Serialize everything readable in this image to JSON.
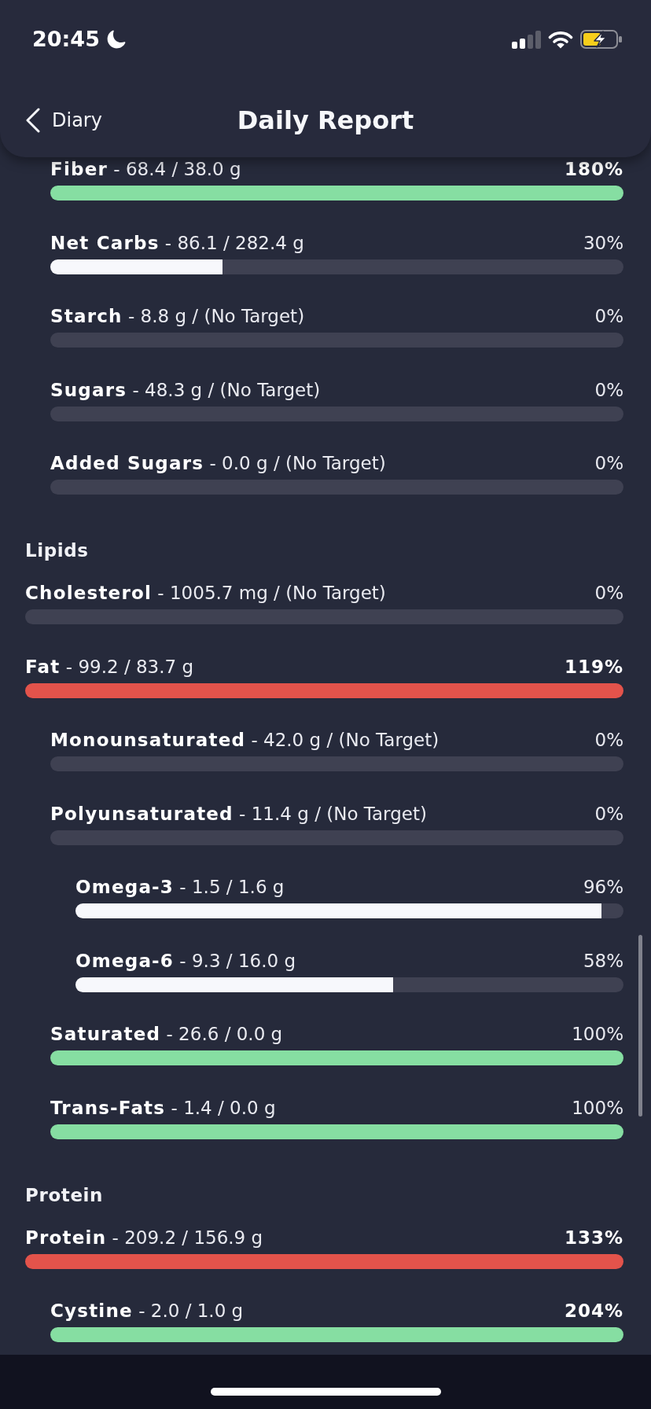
{
  "status_bar": {
    "time": "20:45"
  },
  "nav": {
    "back_label": "Diary",
    "title": "Daily Report"
  },
  "sections": [
    {
      "rows": [
        {
          "children": [
            {
              "label": "**Fiber** - 68.4 / 38.0 g",
              "percent": "180%",
              "highlighted": true,
              "level": 1,
              "color": "#86dea2"
            },
            {
              "label": "**Net Carbs** - 86.1 / 282.4 g",
              "percent": "30%",
              "highlighted": false,
              "level": 0.3,
              "color": "#f7f8fc"
            },
            {
              "label": "**Starch** - 8.8 g / (No Target)",
              "percent": "0%",
              "highlighted": false
            },
            {
              "label": "**Sugars** - 48.3 g / (No Target)",
              "percent": "0%",
              "highlighted": false
            },
            {
              "label": "**Added Sugars** - 0.0 g / (No Target)",
              "percent": "0%",
              "highlighted": false
            }
          ]
        }
      ]
    },
    {
      "heading": "Lipids",
      "rows": [
        {
          "label": "**Cholesterol** - 1005.7 mg / (No Target)",
          "percent": "0%",
          "highlighted": false
        },
        {
          "label": "**Fat** - 99.2 / 83.7 g",
          "percent": "119%",
          "highlighted": true,
          "level": 1,
          "color": "#e3534b",
          "children": [
            {
              "label": "**Monounsaturated** - 42.0 g / (No Target)",
              "percent": "0%",
              "highlighted": false
            },
            {
              "label": "**Polyunsaturated** - 11.4 g / (No Target)",
              "percent": "0%",
              "highlighted": false,
              "children": [
                {
                  "label": "**Omega-3** - 1.5 / 1.6 g",
                  "percent": "96%",
                  "highlighted": false,
                  "level": 0.96,
                  "color": "#f7f8fc"
                },
                {
                  "label": "**Omega-6** - 9.3 / 16.0 g",
                  "percent": "58%",
                  "highlighted": false,
                  "level": 0.58,
                  "color": "#f7f8fc"
                }
              ]
            },
            {
              "label": "**Saturated** - 26.6 / 0.0 g",
              "percent": "100%",
              "highlighted": false,
              "level": 1,
              "color": "#86dea2"
            },
            {
              "label": "**Trans-Fats** - 1.4 / 0.0 g",
              "percent": "100%",
              "highlighted": false,
              "level": 1,
              "color": "#86dea2"
            }
          ]
        }
      ]
    },
    {
      "heading": "Protein",
      "rows": [
        {
          "label": "**Protein** - 209.2 / 156.9 g",
          "percent": "133%",
          "highlighted": true,
          "level": 1,
          "color": "#e3534b",
          "children": [
            {
              "label": "**Cystine** - 2.0 / 1.0 g",
              "percent": "204%",
              "highlighted": true,
              "level": 1,
              "color": "#86dea2"
            }
          ]
        }
      ]
    }
  ]
}
